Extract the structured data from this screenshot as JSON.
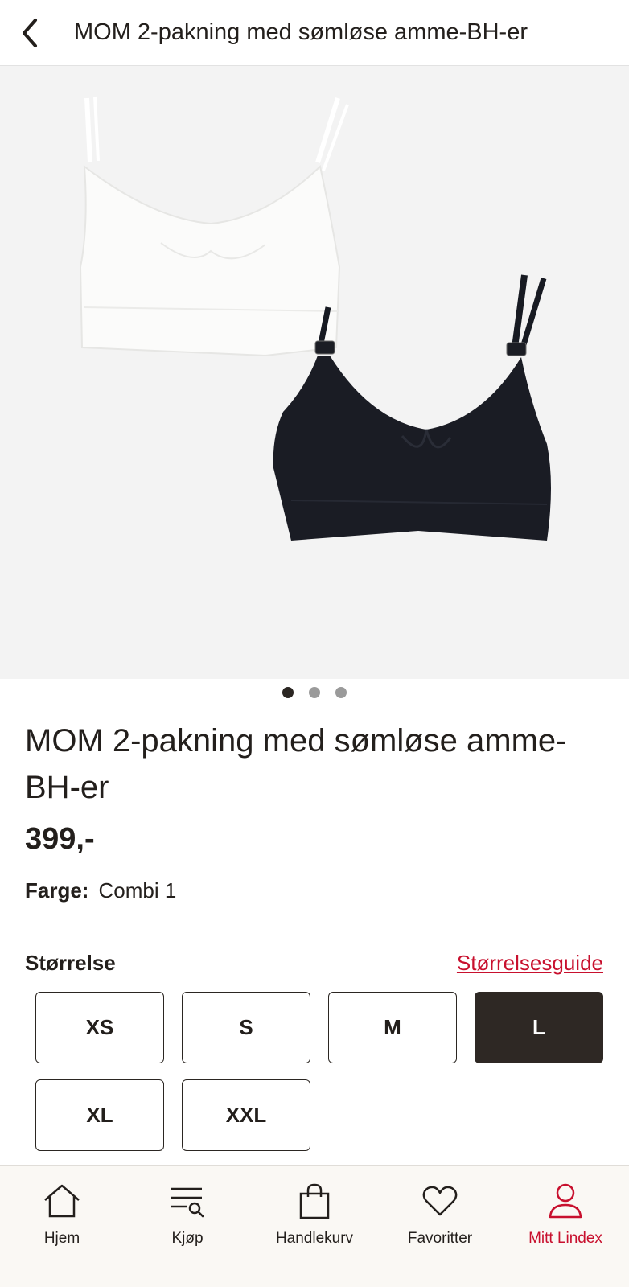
{
  "header": {
    "title": "MOM 2-pakning med sømløse amme-BH-er",
    "back_icon": "chevron-left-icon"
  },
  "gallery": {
    "image_count": 3,
    "active_index": 0
  },
  "product": {
    "title": "MOM 2-pakning med sømløse amme-BH-er",
    "price": "399,-",
    "color_label": "Farge:",
    "color_value": "Combi 1"
  },
  "sizes": {
    "label": "Størrelse",
    "guide_link": "Størrelsesguide",
    "options": [
      "XS",
      "S",
      "M",
      "L",
      "XL",
      "XXL"
    ],
    "selected": "L"
  },
  "nav": {
    "items": [
      {
        "label": "Hjem",
        "icon": "home-icon"
      },
      {
        "label": "Kjøp",
        "icon": "shop-search-icon"
      },
      {
        "label": "Handlekurv",
        "icon": "shopping-bag-icon"
      },
      {
        "label": "Favoritter",
        "icon": "heart-icon"
      },
      {
        "label": "Mitt Lindex",
        "icon": "user-icon"
      }
    ],
    "active": "Mitt Lindex"
  },
  "colors": {
    "accent_red": "#c8102e",
    "selected_dark": "#2e2824",
    "text": "#231f1c",
    "nav_bg": "#faf8f4"
  }
}
